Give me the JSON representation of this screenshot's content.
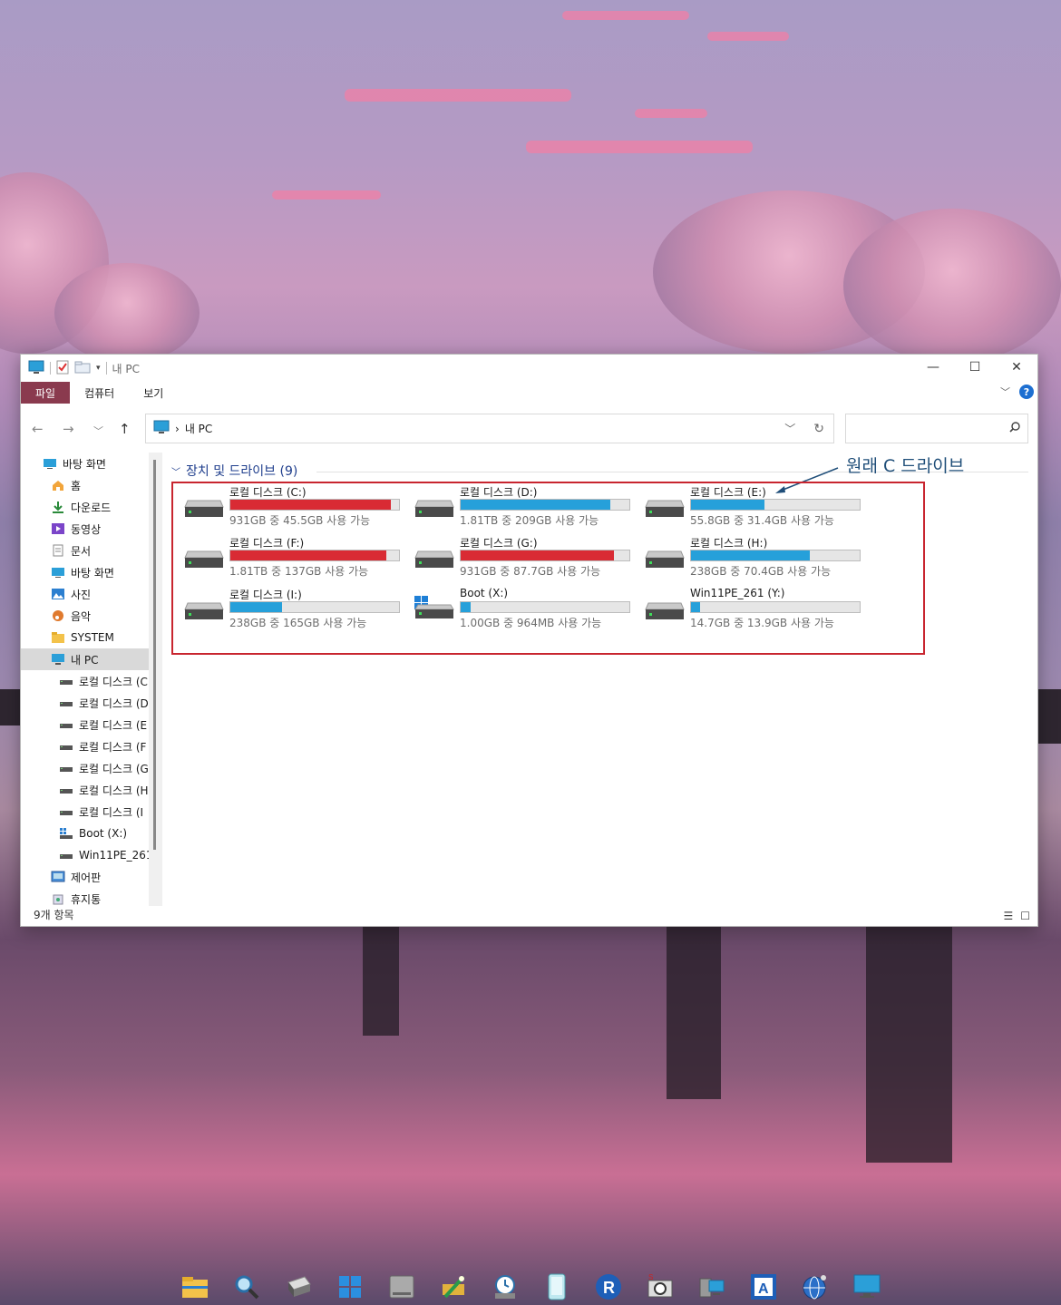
{
  "window": {
    "title": "내 PC",
    "controls": {
      "minimize": "—",
      "maximize": "☐",
      "close": "✕"
    }
  },
  "ribbon": {
    "tabs": [
      {
        "label": "파일",
        "active": true
      },
      {
        "label": "컴퓨터",
        "active": false
      },
      {
        "label": "보기",
        "active": false
      }
    ],
    "help_label": "?"
  },
  "address": {
    "separator": "›",
    "location": "내 PC"
  },
  "search": {
    "placeholder": ""
  },
  "sidebar": {
    "items": [
      {
        "label": "바탕 화면",
        "icon": "desktop-icon",
        "indent": 0
      },
      {
        "label": "홈",
        "icon": "home-icon",
        "indent": 1
      },
      {
        "label": "다운로드",
        "icon": "download-icon",
        "indent": 1
      },
      {
        "label": "동영상",
        "icon": "video-icon",
        "indent": 1
      },
      {
        "label": "문서",
        "icon": "document-icon",
        "indent": 1
      },
      {
        "label": "바탕 화면",
        "icon": "desktop-icon",
        "indent": 1
      },
      {
        "label": "사진",
        "icon": "pictures-icon",
        "indent": 1
      },
      {
        "label": "음악",
        "icon": "music-icon",
        "indent": 1
      },
      {
        "label": "SYSTEM",
        "icon": "folder-icon",
        "indent": 1
      },
      {
        "label": "내 PC",
        "icon": "pc-icon",
        "indent": 1,
        "selected": true
      },
      {
        "label": "로컬 디스크 (C",
        "icon": "drive-icon",
        "indent": 2
      },
      {
        "label": "로컬 디스크 (D",
        "icon": "drive-icon",
        "indent": 2
      },
      {
        "label": "로컬 디스크 (E",
        "icon": "drive-icon",
        "indent": 2
      },
      {
        "label": "로컬 디스크 (F",
        "icon": "drive-icon",
        "indent": 2
      },
      {
        "label": "로컬 디스크 (G",
        "icon": "drive-icon",
        "indent": 2
      },
      {
        "label": "로컬 디스크 (H",
        "icon": "drive-icon",
        "indent": 2
      },
      {
        "label": "로컬 디스크 (I",
        "icon": "drive-icon",
        "indent": 2
      },
      {
        "label": "Boot (X:)",
        "icon": "windows-drive-icon",
        "indent": 2
      },
      {
        "label": "Win11PE_261",
        "icon": "drive-icon",
        "indent": 2
      },
      {
        "label": "제어판",
        "icon": "control-panel-icon",
        "indent": 1
      },
      {
        "label": "휴지통",
        "icon": "recycle-bin-icon",
        "indent": 1
      }
    ]
  },
  "content": {
    "group_header": "장치 및 드라이브 (9)",
    "annotation": "원래 C 드라이브",
    "drives": [
      {
        "name": "로컬 디스크 (C:)",
        "info": "931GB 중 45.5GB 사용 가능",
        "used_fraction": 0.951,
        "bar_color": "#d92b34",
        "icon": "hdd-icon"
      },
      {
        "name": "로컬 디스크 (D:)",
        "info": "1.81TB 중 209GB 사용 가능",
        "used_fraction": 0.887,
        "bar_color": "#26a0da",
        "icon": "hdd-icon"
      },
      {
        "name": "로컬 디스크 (E:)",
        "info": "55.8GB 중 31.4GB 사용 가능",
        "used_fraction": 0.437,
        "bar_color": "#26a0da",
        "icon": "hdd-icon"
      },
      {
        "name": "로컬 디스크 (F:)",
        "info": "1.81TB 중 137GB 사용 가능",
        "used_fraction": 0.926,
        "bar_color": "#d92b34",
        "icon": "hdd-icon"
      },
      {
        "name": "로컬 디스크 (G:)",
        "info": "931GB 중 87.7GB 사용 가능",
        "used_fraction": 0.906,
        "bar_color": "#d92b34",
        "icon": "hdd-icon"
      },
      {
        "name": "로컬 디스크 (H:)",
        "info": "238GB 중 70.4GB 사용 가능",
        "used_fraction": 0.704,
        "bar_color": "#26a0da",
        "icon": "hdd-icon"
      },
      {
        "name": "로컬 디스크 (I:)",
        "info": "238GB 중 165GB 사용 가능",
        "used_fraction": 0.307,
        "bar_color": "#26a0da",
        "icon": "hdd-icon"
      },
      {
        "name": "Boot (X:)",
        "info": "1.00GB 중 964MB 사용 가능",
        "used_fraction": 0.059,
        "bar_color": "#26a0da",
        "icon": "windows-hdd-icon"
      },
      {
        "name": "Win11PE_261 (Y:)",
        "info": "14.7GB 중 13.9GB 사용 가능",
        "used_fraction": 0.054,
        "bar_color": "#26a0da",
        "icon": "hdd-icon"
      }
    ]
  },
  "statusbar": {
    "item_count": "9개 항목"
  },
  "taskbar": {
    "icons": [
      "file-explorer-icon",
      "search-tool-icon",
      "drive-tool-icon",
      "start-grid-icon",
      "disk-icon",
      "wand-icon",
      "backup-icon",
      "phone-icon",
      "r-app-icon",
      "screen-capture-icon",
      "network-icon",
      "a-app-icon",
      "globe-icon",
      "monitor-icon"
    ]
  }
}
